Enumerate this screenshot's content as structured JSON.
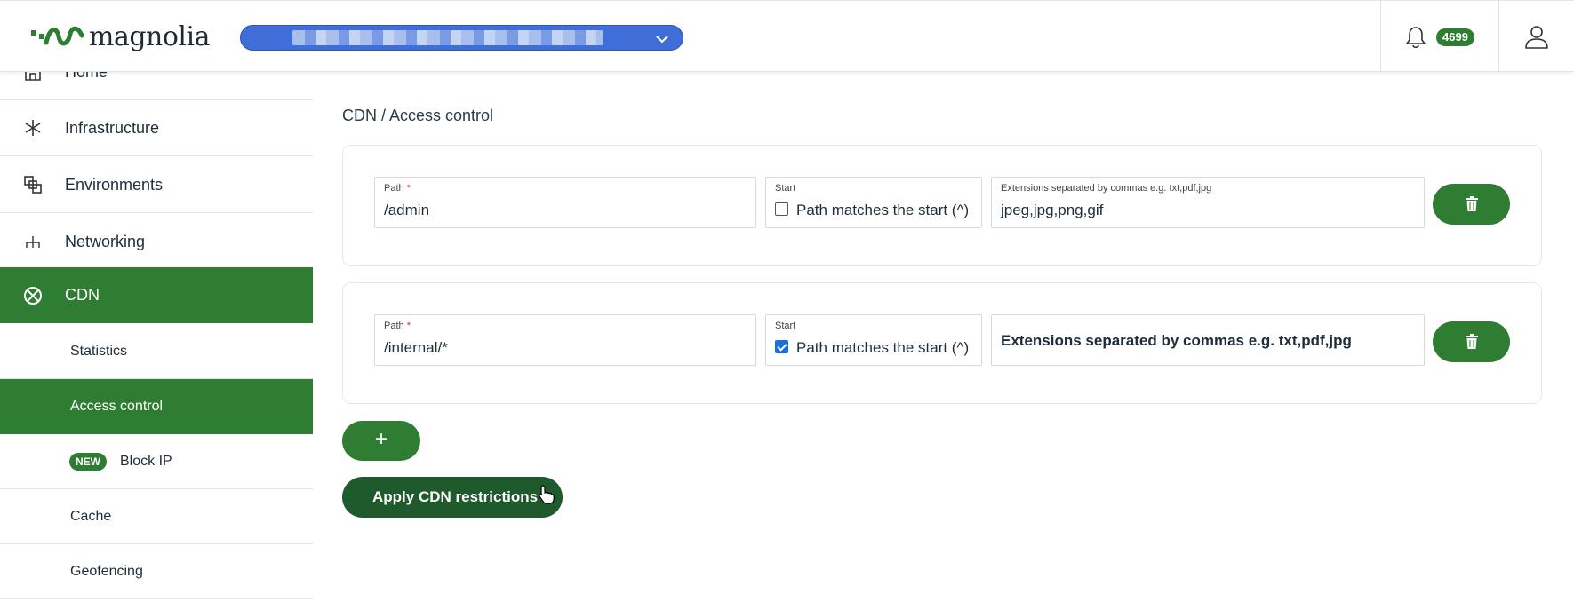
{
  "header": {
    "logo_text": "magnolia",
    "notifications_count": "4699"
  },
  "sidebar": {
    "items": [
      {
        "label": "Home",
        "icon": "home-icon"
      },
      {
        "label": "Infrastructure",
        "icon": "infrastructure-icon"
      },
      {
        "label": "Environments",
        "icon": "environments-icon"
      },
      {
        "label": "Networking",
        "icon": "networking-icon"
      },
      {
        "label": "CDN",
        "icon": "cdn-icon",
        "active": true
      }
    ],
    "sub_items": [
      {
        "label": "Statistics"
      },
      {
        "label": "Access control",
        "active": true
      },
      {
        "label": "Block IP",
        "badge": "NEW"
      },
      {
        "label": "Cache"
      },
      {
        "label": "Geofencing"
      }
    ]
  },
  "main": {
    "breadcrumb": "CDN / Access control",
    "rules": [
      {
        "path_label": "Path",
        "path_value": "/admin",
        "start_label": "Start",
        "start_checkbox_label": "Path matches the start (^)",
        "start_checked": false,
        "extensions_label": "Extensions separated by commas e.g. txt,pdf,jpg",
        "extensions_value": "jpeg,jpg,png,gif"
      },
      {
        "path_label": "Path",
        "path_value": "/internal/*",
        "start_label": "Start",
        "start_checkbox_label": "Path matches the start (^)",
        "start_checked": true,
        "extensions_placeholder": "Extensions separated by commas e.g. txt,pdf,jpg",
        "extensions_value": ""
      }
    ],
    "add_button_label": "+",
    "apply_button_label": "Apply CDN restrictions"
  },
  "colors": {
    "brand_green": "#2e7d32",
    "apply_green": "#1e5a2b",
    "project_select_blue": "#3f6ed8"
  }
}
